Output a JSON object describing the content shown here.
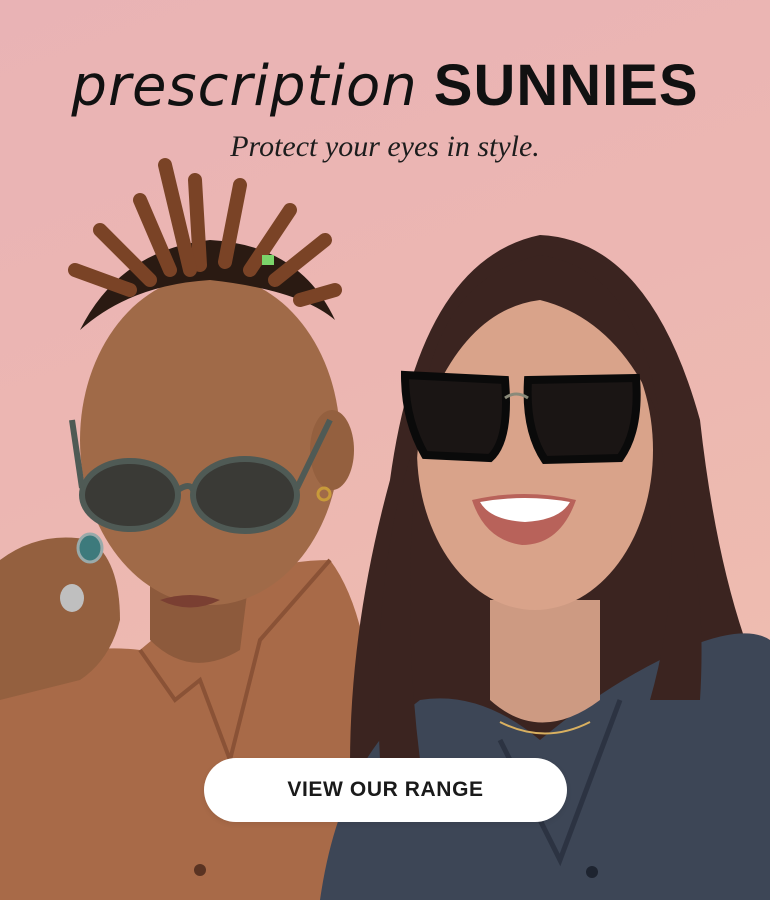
{
  "banner": {
    "headline_script": "prescription",
    "headline_bold": "SUNNIES",
    "subline": "Protect your eyes in style.",
    "cta_label": "VIEW OUR RANGE"
  },
  "colors": {
    "background_top": "#e9b3b5",
    "background_bottom": "#efbfae",
    "cta_background": "#ffffff",
    "text": "#111111"
  },
  "images": {
    "left_model": "man-with-round-sunglasses",
    "right_model": "woman-with-square-sunglasses"
  }
}
